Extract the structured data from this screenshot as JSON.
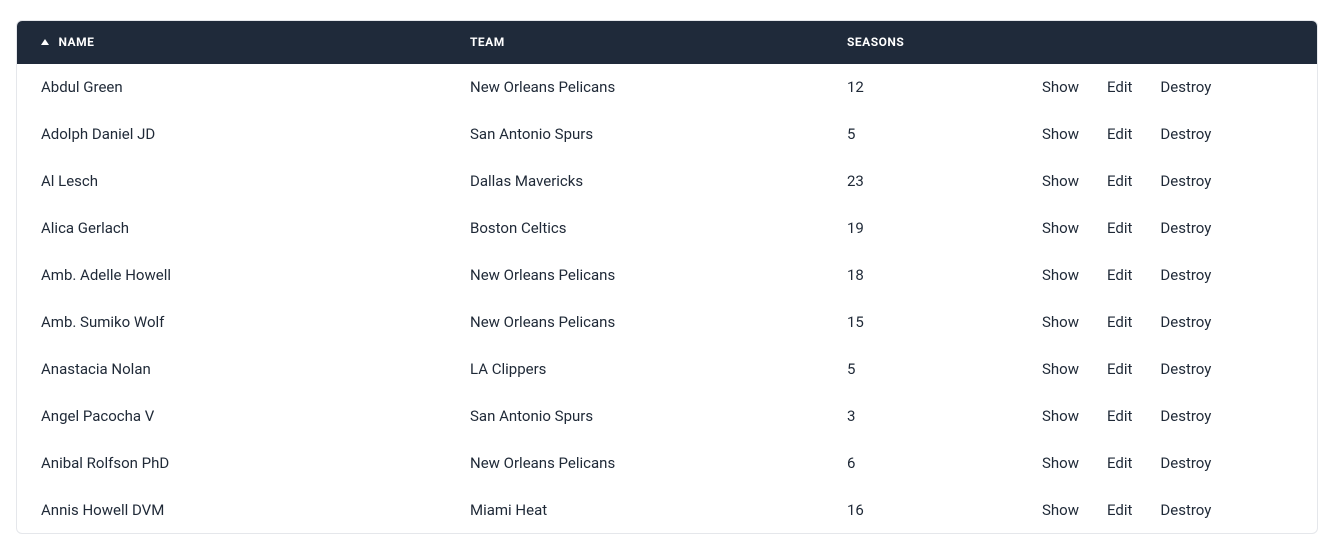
{
  "table": {
    "columns": {
      "name": "NAME",
      "team": "TEAM",
      "seasons": "SEASONS"
    },
    "sort": {
      "column": "name",
      "direction": "asc"
    },
    "actions": {
      "show": "Show",
      "edit": "Edit",
      "destroy": "Destroy"
    },
    "rows": [
      {
        "name": "Abdul Green",
        "team": "New Orleans Pelicans",
        "seasons": "12"
      },
      {
        "name": "Adolph Daniel JD",
        "team": "San Antonio Spurs",
        "seasons": "5"
      },
      {
        "name": "Al Lesch",
        "team": "Dallas Mavericks",
        "seasons": "23"
      },
      {
        "name": "Alica Gerlach",
        "team": "Boston Celtics",
        "seasons": "19"
      },
      {
        "name": "Amb. Adelle Howell",
        "team": "New Orleans Pelicans",
        "seasons": "18"
      },
      {
        "name": "Amb. Sumiko Wolf",
        "team": "New Orleans Pelicans",
        "seasons": "15"
      },
      {
        "name": "Anastacia Nolan",
        "team": "LA Clippers",
        "seasons": "5"
      },
      {
        "name": "Angel Pacocha V",
        "team": "San Antonio Spurs",
        "seasons": "3"
      },
      {
        "name": "Anibal Rolfson PhD",
        "team": "New Orleans Pelicans",
        "seasons": "6"
      },
      {
        "name": "Annis Howell DVM",
        "team": "Miami Heat",
        "seasons": "16"
      }
    ]
  }
}
